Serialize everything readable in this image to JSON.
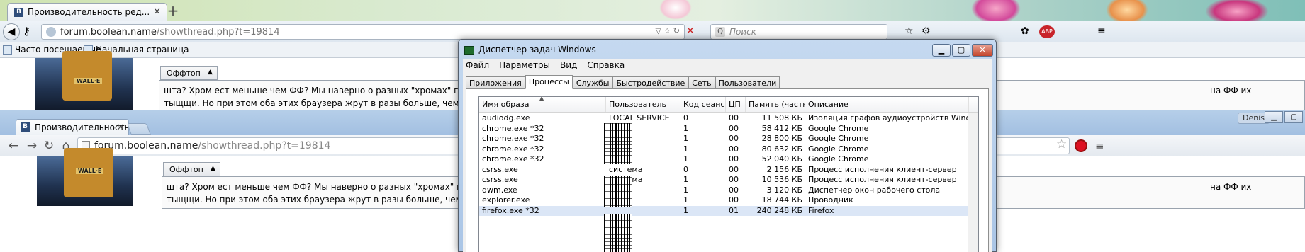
{
  "firefox": {
    "tab_title": "Производительность ред...",
    "tab_close": "×",
    "new_tab": "+",
    "url_host": "forum.boolean.name",
    "url_path": "/showthread.php?t=19814",
    "search_placeholder": "Поиск",
    "bookmarks": [
      "Часто посещаемые",
      "Начальная страница"
    ],
    "abp_badge": "ABP"
  },
  "chrome": {
    "tab_title": "Производительность ред",
    "tab_close": "×",
    "user_label": "Denis",
    "url_host": "forum.boolean.name",
    "url_path": "/showthread.php?t=19814"
  },
  "forum": {
    "offtop_label": "Оффтоп",
    "post_line1": "шта? Хром ест меньше чем ФФ? Мы наверно о разных \"хромах\" говорим, потому",
    "post_line2": "тыщщи. Но при этом оба этих браузера жрут в разы больше, чем старая добрая",
    "post_tail": "на ФФ их",
    "avatar_text": "WALL·E"
  },
  "taskmanager": {
    "title": "Диспетчер задач Windows",
    "menu": [
      "Файл",
      "Параметры",
      "Вид",
      "Справка"
    ],
    "tabs": [
      "Приложения",
      "Процессы",
      "Службы",
      "Быстродействие",
      "Сеть",
      "Пользователи"
    ],
    "active_tab": "Процессы",
    "columns": [
      "Имя образа",
      "Пользователь",
      "Код сеанса",
      "ЦП",
      "Память (частн...",
      "Описание"
    ],
    "rows": [
      [
        "audiodg.exe",
        "LOCAL SERVICE",
        "0",
        "00",
        "11 508 КБ",
        "Изоляция графов аудиоустройств Windows"
      ],
      [
        "chrome.exe *32",
        "",
        "1",
        "00",
        "58 412 КБ",
        "Google Chrome"
      ],
      [
        "chrome.exe *32",
        "",
        "1",
        "00",
        "28 800 КБ",
        "Google Chrome"
      ],
      [
        "chrome.exe *32",
        "",
        "1",
        "00",
        "80 632 КБ",
        "Google Chrome"
      ],
      [
        "chrome.exe *32",
        "",
        "1",
        "00",
        "52 040 КБ",
        "Google Chrome"
      ],
      [
        "csrss.exe",
        "система",
        "0",
        "00",
        "2 156 КБ",
        "Процесс исполнения клиент-сервер"
      ],
      [
        "csrss.exe",
        "система",
        "1",
        "00",
        "10 536 КБ",
        "Процесс исполнения клиент-сервер"
      ],
      [
        "dwm.exe",
        "",
        "1",
        "00",
        "3 120 КБ",
        "Диспетчер окон рабочего стола"
      ],
      [
        "explorer.exe",
        "",
        "1",
        "00",
        "18 744 КБ",
        "Проводник"
      ],
      [
        "firefox.exe *32",
        "",
        "1",
        "01",
        "240 248 КБ",
        "Firefox"
      ]
    ]
  }
}
